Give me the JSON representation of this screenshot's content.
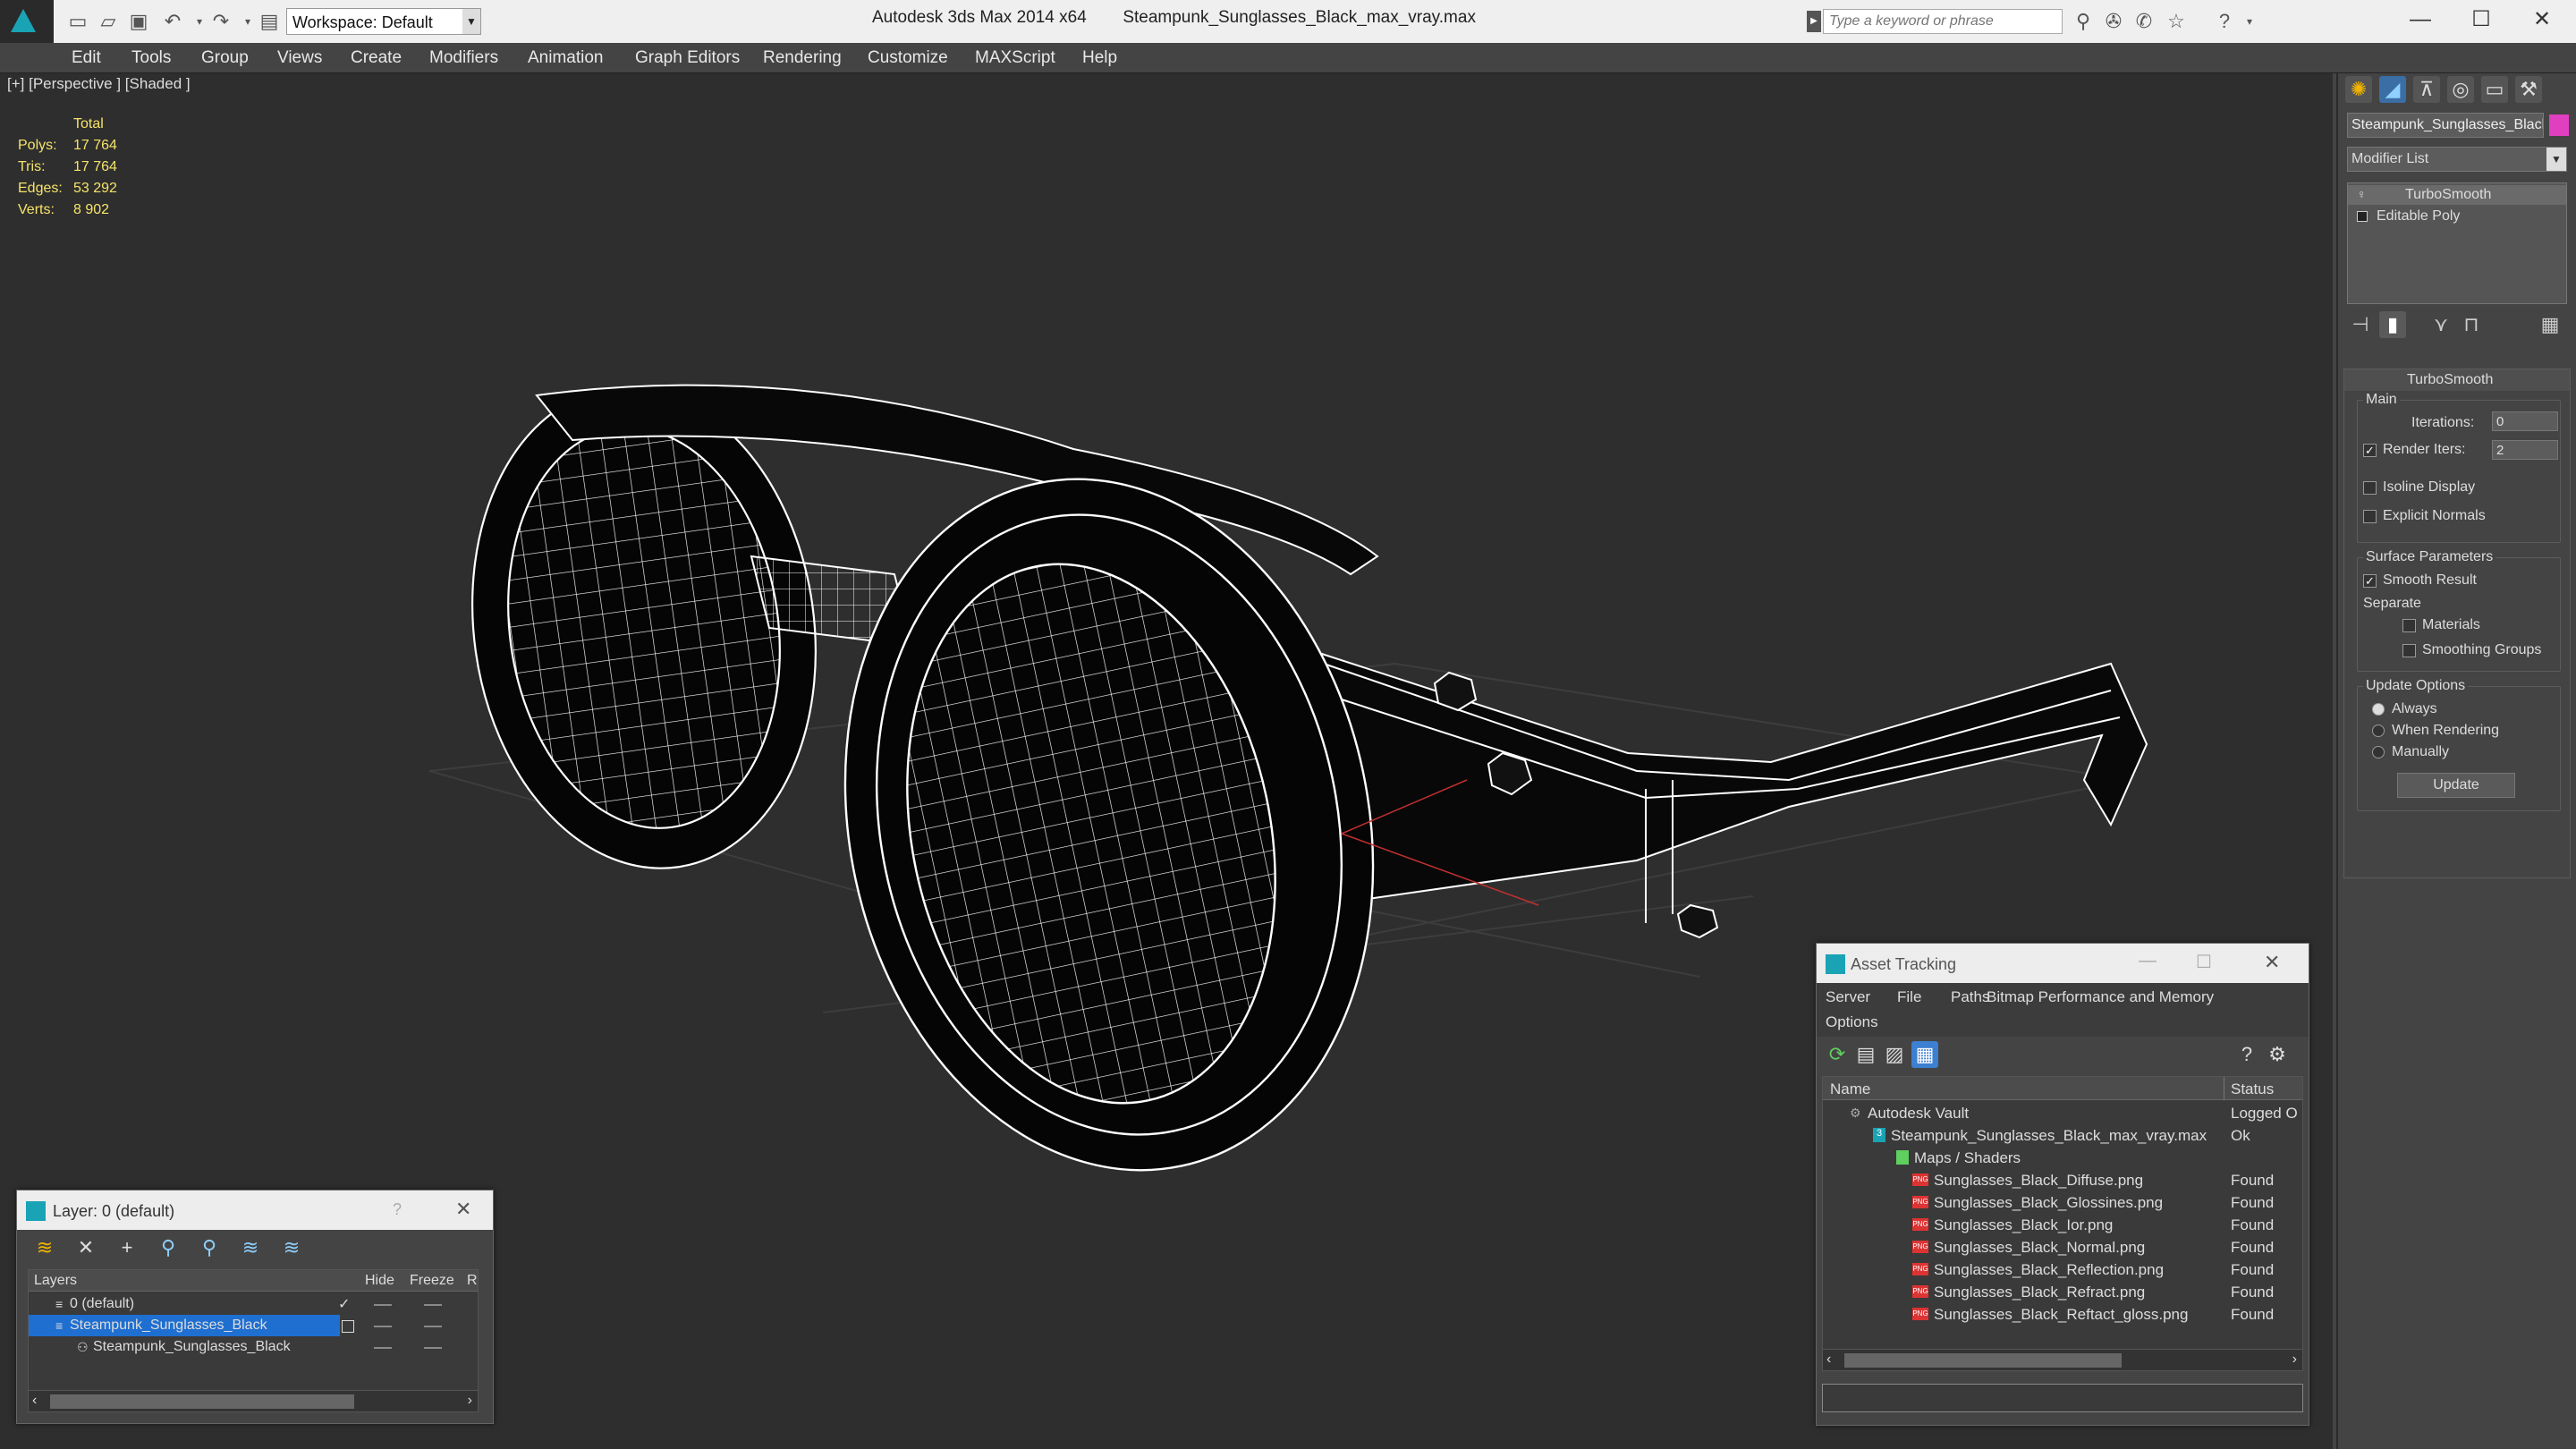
{
  "title": {
    "app": "Autodesk 3ds Max  2014 x64",
    "file": "Steampunk_Sunglasses_Black_max_vray.max",
    "workspace": "Workspace: Default",
    "search_placeholder": "Type a keyword or phrase"
  },
  "menu": [
    "Edit",
    "Tools",
    "Group",
    "Views",
    "Create",
    "Modifiers",
    "Animation",
    "Graph Editors",
    "Rendering",
    "Customize",
    "MAXScript",
    "Help"
  ],
  "viewport": {
    "label": "[+] [Perspective ] [Shaded ]",
    "stats": {
      "header": "Total",
      "rows": [
        {
          "label": "Polys:",
          "value": "17 764"
        },
        {
          "label": "Tris:",
          "value": "17 764"
        },
        {
          "label": "Edges:",
          "value": "53 292"
        },
        {
          "label": "Verts:",
          "value": "8 902"
        }
      ]
    }
  },
  "cmd": {
    "object_name": "Steampunk_Sunglasses_Black",
    "modifier_list": "Modifier List",
    "stack": [
      "TurboSmooth",
      "Editable Poly"
    ],
    "rollout_title": "TurboSmooth",
    "main_label": "Main",
    "iterations_label": "Iterations:",
    "iterations": "0",
    "render_iters_label": "Render Iters:",
    "render_iters": "2",
    "isoline": "Isoline Display",
    "explicit": "Explicit Normals",
    "surface_label": "Surface Parameters",
    "smooth_result": "Smooth Result",
    "separate_label": "Separate",
    "materials": "Materials",
    "smoothing_groups": "Smoothing Groups",
    "update_options": "Update Options",
    "always": "Always",
    "when_rendering": "When Rendering",
    "manually": "Manually",
    "update_btn": "Update"
  },
  "asset": {
    "title": "Asset Tracking",
    "menu": [
      "Server",
      "File",
      "Paths",
      "Bitmap Performance and Memory",
      "Options"
    ],
    "col_name": "Name",
    "col_status": "Status",
    "rows": [
      {
        "name": "Autodesk Vault",
        "status": "Logged O"
      },
      {
        "name": "Steampunk_Sunglasses_Black_max_vray.max",
        "status": "Ok"
      },
      {
        "name": "Maps / Shaders",
        "status": ""
      },
      {
        "name": "Sunglasses_Black_Diffuse.png",
        "status": "Found"
      },
      {
        "name": "Sunglasses_Black_Glossines.png",
        "status": "Found"
      },
      {
        "name": "Sunglasses_Black_Ior.png",
        "status": "Found"
      },
      {
        "name": "Sunglasses_Black_Normal.png",
        "status": "Found"
      },
      {
        "name": "Sunglasses_Black_Reflection.png",
        "status": "Found"
      },
      {
        "name": "Sunglasses_Black_Refract.png",
        "status": "Found"
      },
      {
        "name": "Sunglasses_Black_Reftact_gloss.png",
        "status": "Found"
      }
    ]
  },
  "layer": {
    "title": "Layer: 0 (default)",
    "col_layers": "Layers",
    "col_hide": "Hide",
    "col_freeze": "Freeze",
    "col_r": "R",
    "rows": [
      "0 (default)",
      "Steampunk_Sunglasses_Black",
      "Steampunk_Sunglasses_Black"
    ]
  },
  "colors": {
    "accent": "#3399ff",
    "object_color": "#e040c0",
    "selected": "#1f6fd1"
  }
}
